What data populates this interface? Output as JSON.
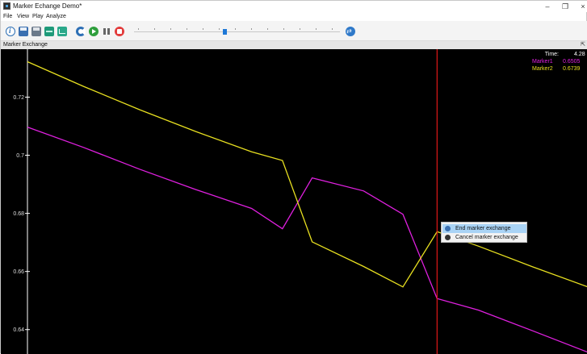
{
  "window": {
    "title": "Marker Echange Demo*",
    "minimize_glyph": "–",
    "maximize_glyph": "❐",
    "close_glyph": "×"
  },
  "menu": {
    "items": [
      "File",
      "View",
      "Play",
      "Analyze"
    ]
  },
  "toolbar": {
    "icons": [
      "info-icon",
      "save-icon",
      "save-as-icon",
      "waveform-icon",
      "chart-icon",
      "refresh-icon",
      "play-icon",
      "pause-icon",
      "stop-icon",
      "marker-swap-icon"
    ],
    "slider_level": 0.44,
    "marker_swap_label": "⇄"
  },
  "panel": {
    "title": "Marker Exchange",
    "pin_glyph": "⇱"
  },
  "readout": {
    "time_label": "Time:",
    "marker1_label": "Marker1",
    "marker2_label": "Marker2",
    "time_value": "4.28",
    "marker1_value": "0.6505",
    "marker2_value": "0.6739",
    "marker1_color": "#e020e0",
    "marker2_color": "#e8e020",
    "time_color": "#ffffff"
  },
  "chart_data": {
    "type": "line",
    "y_ticks": [
      "0.72",
      "0.7",
      "0.68",
      "0.66",
      "0.64"
    ],
    "ylim": [
      0.6316,
      0.7365
    ],
    "xlim": [
      0,
      10
    ],
    "cursor_x": 7.31,
    "cursor_color": "#e01818",
    "series": [
      {
        "name": "Marker1",
        "color": "#e020e0",
        "x": [
          0,
          1.0,
          2.0,
          3.0,
          4.0,
          4.55,
          5.08,
          6.0,
          6.7,
          7.31,
          8.05,
          9.0,
          10.0
        ],
        "y": [
          0.7097,
          0.7027,
          0.6952,
          0.6882,
          0.6817,
          0.6747,
          0.6922,
          0.6877,
          0.6797,
          0.6507,
          0.6467,
          0.6397,
          0.6322
        ]
      },
      {
        "name": "Marker2",
        "color": "#e8e020",
        "x": [
          0,
          1.0,
          2.0,
          3.0,
          4.0,
          4.55,
          5.08,
          6.0,
          6.7,
          7.31,
          8.05,
          9.0,
          10.0
        ],
        "y": [
          0.7322,
          0.7237,
          0.7157,
          0.7082,
          0.7012,
          0.6982,
          0.6702,
          0.6617,
          0.6547,
          0.6737,
          0.6687,
          0.6617,
          0.6547
        ]
      }
    ]
  },
  "context_menu": {
    "items": [
      {
        "label": "End marker exchange"
      },
      {
        "label": "Cancel marker exchange"
      }
    ]
  }
}
